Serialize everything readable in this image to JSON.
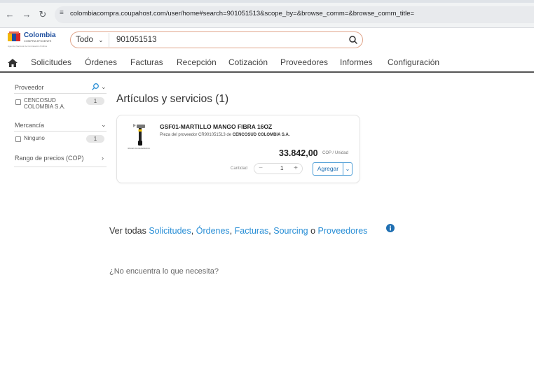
{
  "browser": {
    "url": "colombiacompra.coupahost.com/user/home#search=901051513&scope_by=&browse_comm=&browse_comm_title="
  },
  "logo": {
    "name": "Colombia",
    "subtitle": "COMPRA EFICIENTE",
    "footer": "Agencia Nacional de Contratación Pública"
  },
  "search": {
    "scope": "Todo",
    "value": "901051513"
  },
  "nav": {
    "items": [
      "Solicitudes",
      "Órdenes",
      "Facturas",
      "Recepción",
      "Cotización",
      "Proveedores",
      "Informes",
      "Configuración"
    ]
  },
  "sidebar": {
    "supplier": {
      "title": "Proveedor",
      "option_line1": "CENCOSUD",
      "option_line2": "COLOMBIA S.A.",
      "count": "1"
    },
    "commodity": {
      "title": "Mercancía",
      "option": "Ninguno",
      "count": "1"
    },
    "price_range": {
      "title": "Rango de precios (COP)"
    }
  },
  "results": {
    "title": "Artículos y servicios (1)",
    "item": {
      "name": "GSF01-MARTILLO MANGO FIBRA 16OZ",
      "part_prefix": "Pieza del proveedor CR901051513 de",
      "supplier": "CENCOSUD COLOMBIA S.A.",
      "price": "33.842,00",
      "unit": "COP / Unidad",
      "qty_label": "Cantidad",
      "qty": "1",
      "add_label": "Agregar",
      "image_caption": "IMAGEN DE REFERENCIA"
    }
  },
  "see_all": {
    "prefix": "Ver todas",
    "links": [
      "Solicitudes",
      "Órdenes",
      "Facturas",
      "Sourcing",
      "Proveedores"
    ],
    "sep1": ",",
    "sep2": ",",
    "sep3": ",",
    "or": "o"
  },
  "not_found": "¿No encuentra lo que necesita?",
  "colors": {
    "accent": "#2a8fd6",
    "search_border": "#e0a58b",
    "nav_rule": "#555555"
  }
}
